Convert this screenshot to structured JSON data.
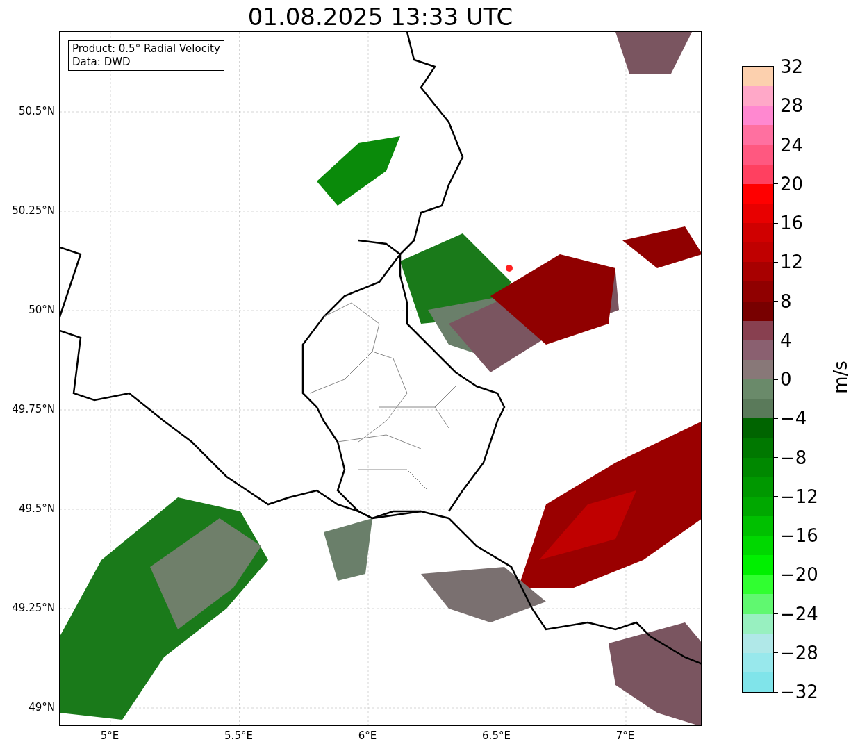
{
  "title": "01.08.2025 13:33 UTC",
  "info_box": [
    "Product: 0.5° Radial Velocity",
    "Data: DWD"
  ],
  "y_ticks": [
    "50.5°N",
    "50.25°N",
    "50°N",
    "49.75°N",
    "49.5°N",
    "49.25°N",
    "49°N"
  ],
  "x_ticks": [
    "5°E",
    "5.5°E",
    "6°E",
    "6.5°E",
    "7°E"
  ],
  "colorbar": {
    "label": "m/s",
    "ticks": [
      "32",
      "28",
      "24",
      "20",
      "16",
      "12",
      "8",
      "4",
      "0",
      "−4",
      "−8",
      "−12",
      "−16",
      "−20",
      "−24",
      "−28",
      "−32"
    ],
    "bands": [
      {
        "color": "#fcd0ae"
      },
      {
        "color": "#ffa8c8"
      },
      {
        "color": "#ff88d0"
      },
      {
        "color": "#ff70a0"
      },
      {
        "color": "#ff5880"
      },
      {
        "color": "#ff4060"
      },
      {
        "color": "#ff0000"
      },
      {
        "color": "#e80000"
      },
      {
        "color": "#d00000"
      },
      {
        "color": "#c00000"
      },
      {
        "color": "#a80000"
      },
      {
        "color": "#900000"
      },
      {
        "color": "#780000"
      },
      {
        "color": "#884050"
      },
      {
        "color": "#8a6070"
      },
      {
        "color": "#887878"
      },
      {
        "color": "#6a8a6a"
      },
      {
        "color": "#5a7a5a"
      },
      {
        "color": "#006400"
      },
      {
        "color": "#007800"
      },
      {
        "color": "#008800"
      },
      {
        "color": "#009800"
      },
      {
        "color": "#00a800"
      },
      {
        "color": "#00c000"
      },
      {
        "color": "#00d800"
      },
      {
        "color": "#00f000"
      },
      {
        "color": "#30ff30"
      },
      {
        "color": "#60f870"
      },
      {
        "color": "#98f0c0"
      },
      {
        "color": "#b0e8e8"
      },
      {
        "color": "#98e8ec"
      },
      {
        "color": "#80e4ea"
      }
    ]
  }
}
